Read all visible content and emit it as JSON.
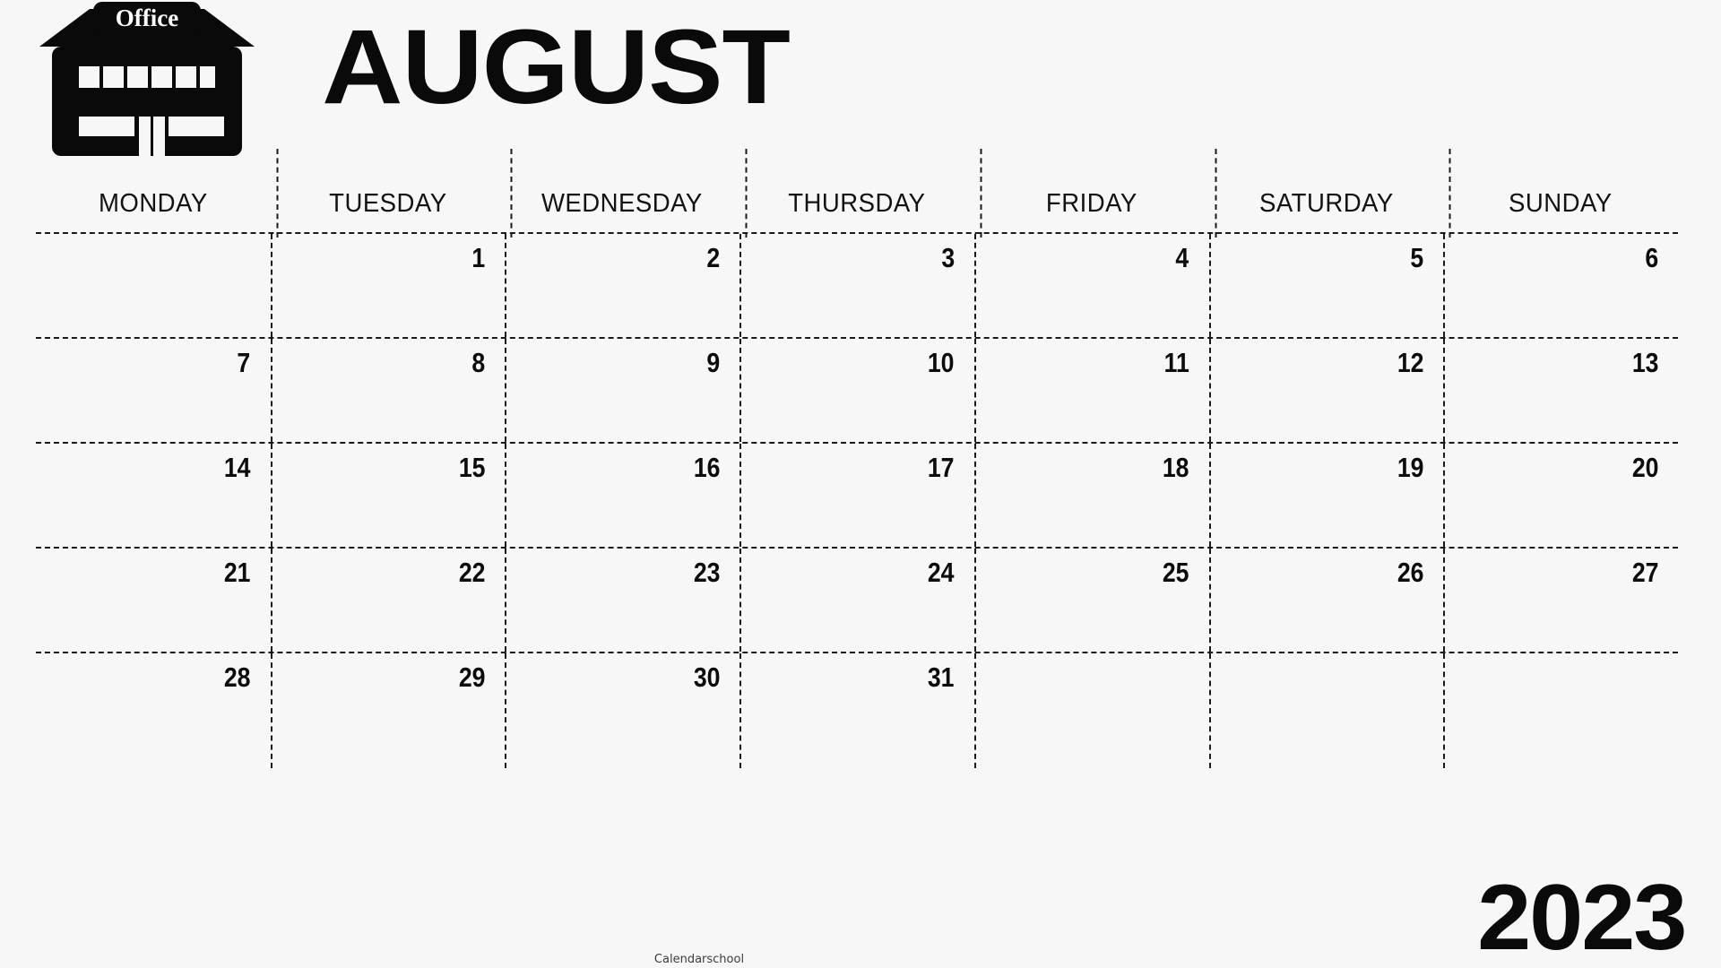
{
  "header": {
    "month_title": "AUGUST",
    "year": "2023",
    "logo_label": "Office"
  },
  "calendar": {
    "weekdays": [
      "MONDAY",
      "TUESDAY",
      "WEDNESDAY",
      "THURSDAY",
      "FRIDAY",
      "SATURDAY",
      "SUNDAY"
    ],
    "weeks": [
      [
        "",
        "1",
        "2",
        "3",
        "4",
        "5",
        "6"
      ],
      [
        "7",
        "8",
        "9",
        "10",
        "11",
        "12",
        "13"
      ],
      [
        "14",
        "15",
        "16",
        "17",
        "18",
        "19",
        "20"
      ],
      [
        "21",
        "22",
        "23",
        "24",
        "25",
        "26",
        "27"
      ],
      [
        "28",
        "29",
        "30",
        "31",
        "",
        "",
        ""
      ]
    ]
  },
  "footer": {
    "watermark": "Calendarschool"
  },
  "colors": {
    "background": "#f7f7f7",
    "ink": "#0a0a0a",
    "grid_line": "#1a1a1a"
  }
}
